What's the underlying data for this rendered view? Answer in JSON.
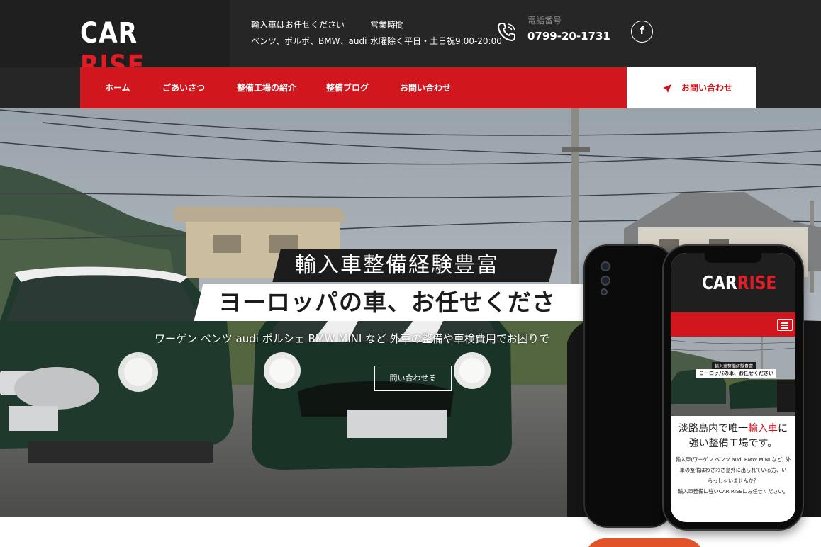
{
  "logo": {
    "part1": "CAR",
    "part2": "RISE"
  },
  "header": {
    "info1": {
      "line1": "輸入車はお任せください",
      "line2": "ベンツ、ボルボ、BMW、audi"
    },
    "info2": {
      "line1": "営業時間",
      "line2": "水曜除く平日・土日祝9:00-20:00"
    },
    "phone": {
      "label": "電話番号",
      "number": "0799-20-1731"
    },
    "social_icon": "f"
  },
  "nav": {
    "items": [
      {
        "label": "ホーム"
      },
      {
        "label": "ごあいさつ"
      },
      {
        "label": "整備工場の紹介"
      },
      {
        "label": "整備ブログ"
      },
      {
        "label": "お問い合わせ"
      }
    ],
    "cta_label": "お問い合わせ"
  },
  "hero": {
    "title1": "輸入車整備経験豊富",
    "title2": "ヨーロッパの車、お任せくださ",
    "subtitle": "ワーゲン ベンツ audi ポルシェ BMW MINI など 外車の整備や車検費用でお困りで",
    "button": "問い合わせる"
  },
  "mobile": {
    "logo": {
      "part1": "CAR",
      "part2": "RISE"
    },
    "hero_title1": "輸入車整備経験豊富",
    "hero_title2": "ヨーロッパの車、お任せください",
    "heading_part1": "淡路島内で唯一",
    "heading_highlight": "輸入車",
    "heading_part2": "に",
    "heading_line2": "強い整備工場です。",
    "para_line1": "輸入車(ワーゲン ベンツ audi BMW MINI など) 外",
    "para_line2": "車の整備はわざわざ島外に出られている方、い",
    "para_line3": "らっしゃいませんか？",
    "para_line4": "輸入車整備に強いCAR RISEにお任せください。"
  },
  "colors": {
    "brand_red": "#d1161d",
    "dark": "#262626",
    "white": "#ffffff"
  }
}
